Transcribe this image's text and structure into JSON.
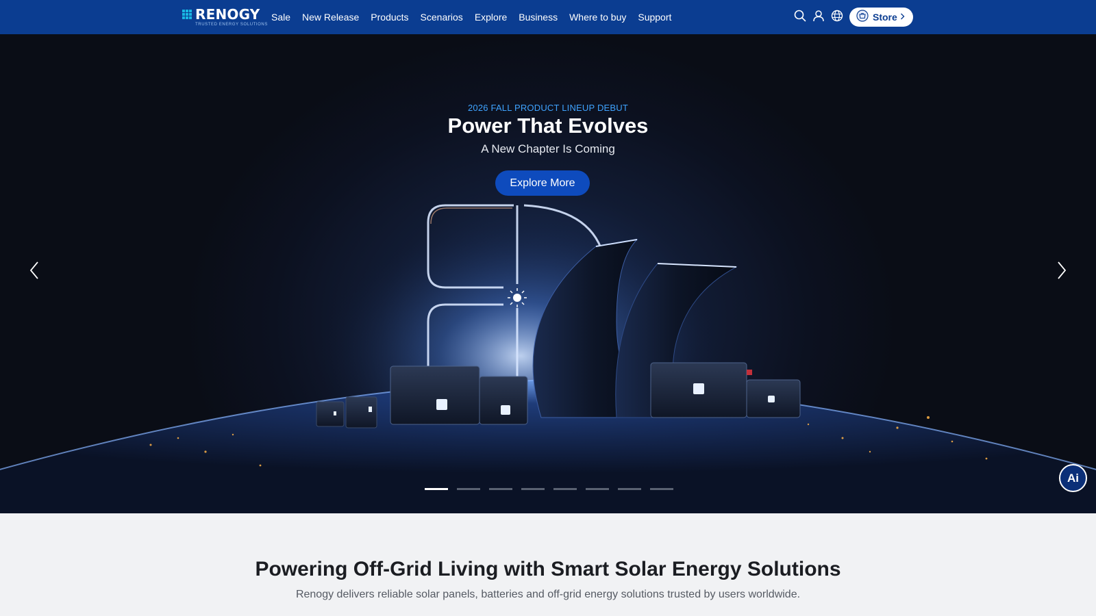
{
  "nav": {
    "logo_word": "RENOGY",
    "logo_tagline": "TRUSTED ENERGY SOLUTIONS",
    "links": [
      "Sale",
      "New Release",
      "Products",
      "Scenarios",
      "Explore",
      "Business",
      "Where to buy",
      "Support"
    ],
    "icons": [
      "search-icon",
      "account-icon",
      "globe-icon"
    ],
    "store_label": "Store"
  },
  "hero": {
    "eyebrow": "2026 FALL PRODUCT LINEUP DEBUT",
    "title": "Power That Evolves",
    "subtitle": "A New Chapter Is Coming",
    "cta_label": "Explore More",
    "slide_count": 8,
    "active_slide": 1,
    "ai_label": "Ai"
  },
  "section": {
    "title": "Powering Off-Grid Living with Smart Solar Energy Solutions",
    "subtitle": "Renogy delivers reliable solar panels, batteries and off-grid energy solutions trusted by users worldwide."
  },
  "colors": {
    "nav_bg": "#0b3d91",
    "accent_blue": "#0e4bbd",
    "eyebrow_blue": "#3fa3ff",
    "page_bg": "#f1f2f4"
  }
}
